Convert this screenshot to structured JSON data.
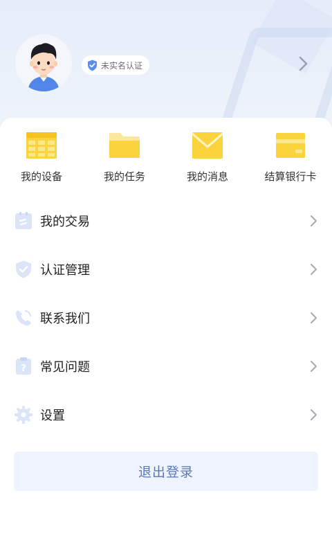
{
  "profile": {
    "verify_badge": "未实名认证"
  },
  "shortcuts": [
    {
      "label": "我的设备",
      "icon": "device-table-icon"
    },
    {
      "label": "我的任务",
      "icon": "folder-icon"
    },
    {
      "label": "我的消息",
      "icon": "envelope-icon"
    },
    {
      "label": "结算银行卡",
      "icon": "bank-card-icon"
    }
  ],
  "menu": [
    {
      "label": "我的交易",
      "icon": "transaction-icon"
    },
    {
      "label": "认证管理",
      "icon": "shield-icon"
    },
    {
      "label": "联系我们",
      "icon": "phone-icon"
    },
    {
      "label": "常见问题",
      "icon": "question-icon"
    },
    {
      "label": "设置",
      "icon": "gear-icon"
    }
  ],
  "logout_label": "退出登录",
  "colors": {
    "accent_yellow": "#fbd33c",
    "icon_blue": "#dbe5f7",
    "logout_text": "#5a79b3",
    "logout_bg": "#eef3fd"
  }
}
